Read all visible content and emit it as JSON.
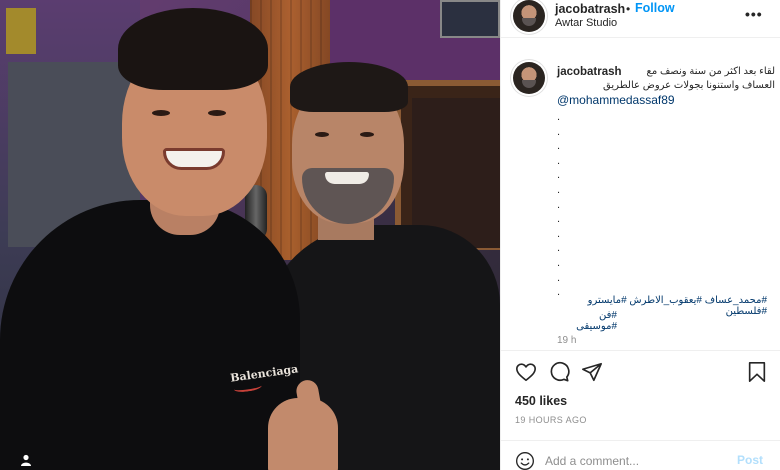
{
  "post": {
    "username": "jacobatrash",
    "follow_label": "Follow",
    "separator": "•",
    "location": "Awtar Studio",
    "more_label": "•••"
  },
  "caption": {
    "username": "jacobatrash",
    "line1": "لقاء بعد اكثر من سنة ونصف مع",
    "line2": "العساف واستنونا بجولات عروض عالطريق",
    "mention": "@mohammedassaf89",
    "dots": [
      ".",
      ".",
      ".",
      ".",
      ".",
      ".",
      ".",
      ".",
      ".",
      ".",
      ".",
      ".",
      "."
    ],
    "hashtags_line1": "#محمد_عساف #يعقوب_الاطرش #مايسترو #فلسطين",
    "hashtags_line2": "#فن #موسيقى",
    "time": "19 h"
  },
  "photo": {
    "shirt_logo": "Balenciaga"
  },
  "stats": {
    "likes": "450 likes",
    "ago": "19 HOURS AGO"
  },
  "comment": {
    "placeholder": "Add a comment...",
    "post_label": "Post"
  },
  "colors": {
    "link": "#0095f6",
    "mention": "#00376b",
    "muted": "#8e8e8e",
    "post_disabled": "#b2dffc"
  },
  "icons": {
    "like": "heart-icon",
    "comment": "comment-bubble-icon",
    "share": "paper-plane-icon",
    "save": "bookmark-icon",
    "emoji": "smiley-icon",
    "user_tag": "person-icon",
    "more": "more-horizontal-icon"
  }
}
